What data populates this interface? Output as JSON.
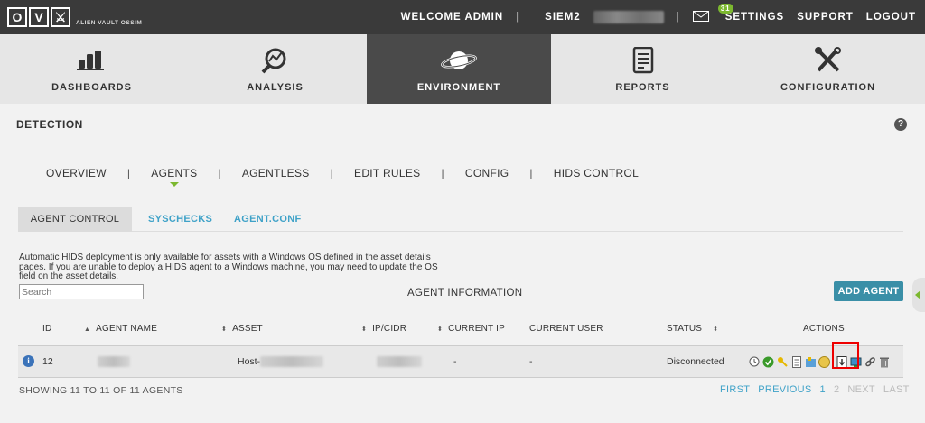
{
  "header": {
    "logo_letters": [
      "O",
      "V",
      "⚔"
    ],
    "logo_sub": "ALIEN VAULT OSSIM",
    "welcome": "WELCOME ADMIN",
    "sensor": "SIEM2",
    "mail_count": "31",
    "settings": "SETTINGS",
    "support": "SUPPORT",
    "logout": "LOGOUT"
  },
  "mainnav": {
    "items": [
      {
        "label": "DASHBOARDS",
        "icon": "bar-chart-icon"
      },
      {
        "label": "ANALYSIS",
        "icon": "magnifier-chart-icon"
      },
      {
        "label": "ENVIRONMENT",
        "icon": "planet-icon",
        "active": true
      },
      {
        "label": "REPORTS",
        "icon": "report-document-icon"
      },
      {
        "label": "CONFIGURATION",
        "icon": "tools-icon"
      }
    ]
  },
  "page": {
    "title": "DETECTION",
    "help": "?"
  },
  "subnav": {
    "items": [
      "OVERVIEW",
      "AGENTS",
      "AGENTLESS",
      "EDIT RULES",
      "CONFIG",
      "HIDS CONTROL"
    ],
    "active": "AGENTS"
  },
  "tabs": {
    "agent_control": "AGENT CONTROL",
    "syschecks": "SYSCHECKS",
    "agent_conf": "AGENT.CONF"
  },
  "notice": "Automatic HIDS deployment is only available for assets with a Windows OS defined in the asset details pages. If you are unable to deploy a HIDS agent to a Windows machine, you may need to update the OS field on the asset details.",
  "search": {
    "placeholder": "Search"
  },
  "table": {
    "title": "AGENT INFORMATION",
    "add_button": "ADD AGENT",
    "columns": [
      "ID",
      "AGENT NAME",
      "ASSET",
      "IP/CIDR",
      "CURRENT IP",
      "CURRENT USER",
      "STATUS",
      "ACTIONS"
    ],
    "rows": [
      {
        "id": "12",
        "agent_name": "",
        "asset": "Host-",
        "ip_cidr": "",
        "current_ip": "-",
        "current_user": "-",
        "status": "Disconnected"
      }
    ],
    "actions_icons": [
      "clock-icon",
      "check-icon",
      "key-icon",
      "document-icon",
      "config-icon",
      "coin-icon",
      "download-icon",
      "monitor-icon",
      "link-icon",
      "trash-icon"
    ]
  },
  "footer": {
    "showing": "SHOWING 11 TO 11 OF 11 AGENTS",
    "first": "FIRST",
    "previous": "PREVIOUS",
    "page1": "1",
    "page2": "2",
    "next": "NEXT",
    "last": "LAST"
  },
  "colors": {
    "topbar": "#3a3a3a",
    "accent_green": "#7cb82f",
    "link_blue": "#3fa2c8",
    "button_teal": "#3a8fa7",
    "highlight_red": "#e00000"
  }
}
